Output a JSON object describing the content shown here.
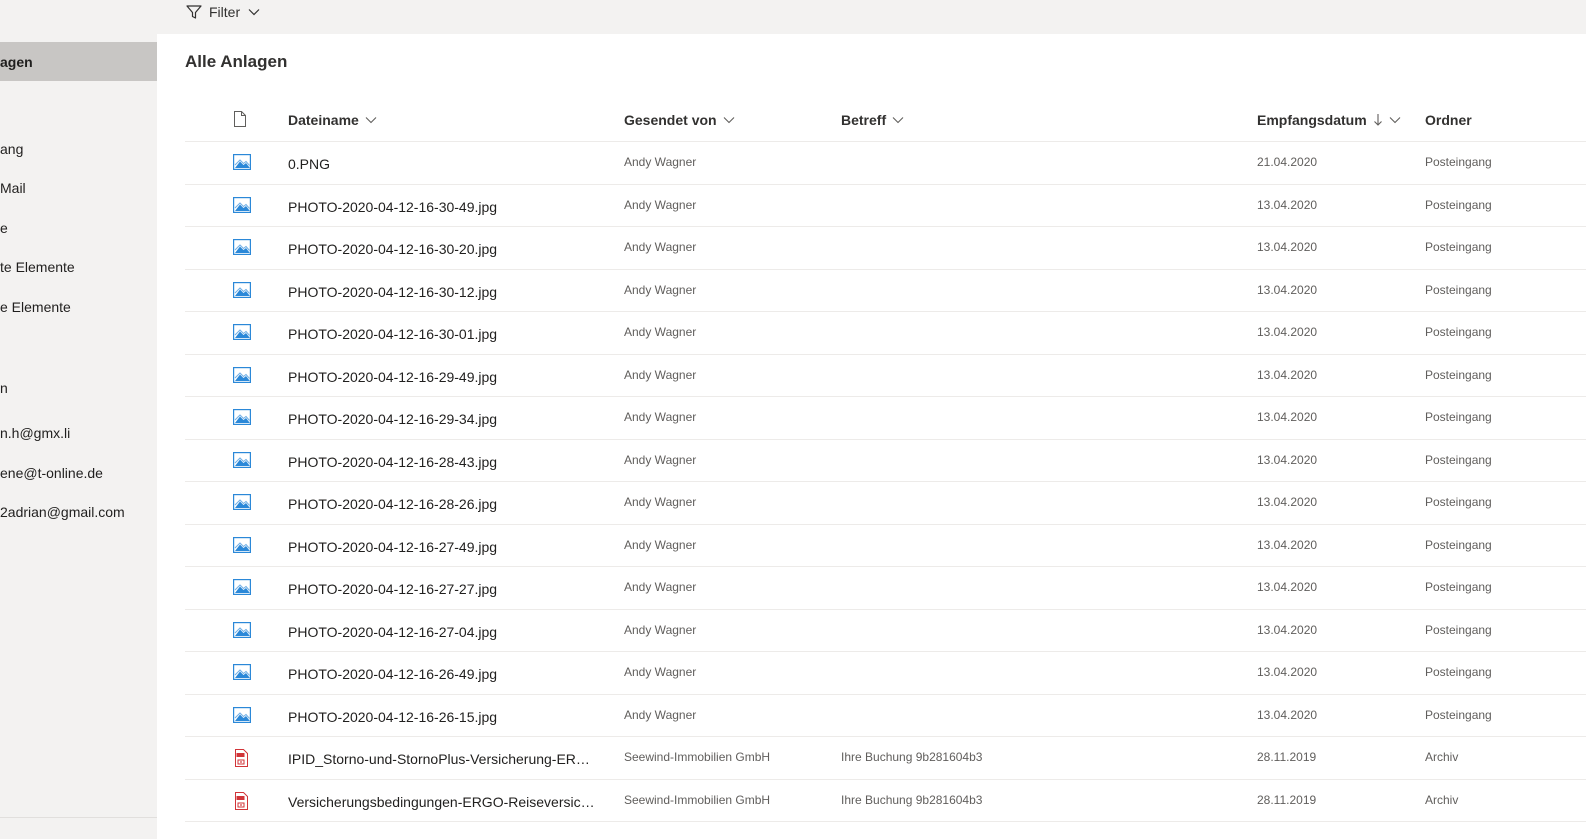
{
  "toolbar": {
    "filter_label": "Filter"
  },
  "sidebar": {
    "items": [
      {
        "label": "agen",
        "selected": true
      },
      {
        "label": "ang"
      },
      {
        "label": "Mail"
      },
      {
        "label": "e"
      },
      {
        "label": "te Elemente"
      },
      {
        "label": "e Elemente"
      },
      {
        "label": "n"
      },
      {
        "label": "n.h@gmx.li"
      },
      {
        "label": "ene@t-online.de"
      },
      {
        "label": "2adrian@gmail.com"
      }
    ]
  },
  "main": {
    "title": "Alle Anlagen",
    "columns": {
      "filename": "Dateiname",
      "sender": "Gesendet von",
      "subject": "Betreff",
      "date": "Empfangsdatum",
      "folder": "Ordner"
    },
    "rows": [
      {
        "icon": "image-file-icon",
        "filename": "0.PNG",
        "sender": "Andy Wagner",
        "subject": "",
        "date": "21.04.2020",
        "folder": "Posteingang"
      },
      {
        "icon": "image-file-icon",
        "filename": "PHOTO-2020-04-12-16-30-49.jpg",
        "sender": "Andy Wagner",
        "subject": "",
        "date": "13.04.2020",
        "folder": "Posteingang"
      },
      {
        "icon": "image-file-icon",
        "filename": "PHOTO-2020-04-12-16-30-20.jpg",
        "sender": "Andy Wagner",
        "subject": "",
        "date": "13.04.2020",
        "folder": "Posteingang"
      },
      {
        "icon": "image-file-icon",
        "filename": "PHOTO-2020-04-12-16-30-12.jpg",
        "sender": "Andy Wagner",
        "subject": "",
        "date": "13.04.2020",
        "folder": "Posteingang"
      },
      {
        "icon": "image-file-icon",
        "filename": "PHOTO-2020-04-12-16-30-01.jpg",
        "sender": "Andy Wagner",
        "subject": "",
        "date": "13.04.2020",
        "folder": "Posteingang"
      },
      {
        "icon": "image-file-icon",
        "filename": "PHOTO-2020-04-12-16-29-49.jpg",
        "sender": "Andy Wagner",
        "subject": "",
        "date": "13.04.2020",
        "folder": "Posteingang"
      },
      {
        "icon": "image-file-icon",
        "filename": "PHOTO-2020-04-12-16-29-34.jpg",
        "sender": "Andy Wagner",
        "subject": "",
        "date": "13.04.2020",
        "folder": "Posteingang"
      },
      {
        "icon": "image-file-icon",
        "filename": "PHOTO-2020-04-12-16-28-43.jpg",
        "sender": "Andy Wagner",
        "subject": "",
        "date": "13.04.2020",
        "folder": "Posteingang"
      },
      {
        "icon": "image-file-icon",
        "filename": "PHOTO-2020-04-12-16-28-26.jpg",
        "sender": "Andy Wagner",
        "subject": "",
        "date": "13.04.2020",
        "folder": "Posteingang"
      },
      {
        "icon": "image-file-icon",
        "filename": "PHOTO-2020-04-12-16-27-49.jpg",
        "sender": "Andy Wagner",
        "subject": "",
        "date": "13.04.2020",
        "folder": "Posteingang"
      },
      {
        "icon": "image-file-icon",
        "filename": "PHOTO-2020-04-12-16-27-27.jpg",
        "sender": "Andy Wagner",
        "subject": "",
        "date": "13.04.2020",
        "folder": "Posteingang"
      },
      {
        "icon": "image-file-icon",
        "filename": "PHOTO-2020-04-12-16-27-04.jpg",
        "sender": "Andy Wagner",
        "subject": "",
        "date": "13.04.2020",
        "folder": "Posteingang"
      },
      {
        "icon": "image-file-icon",
        "filename": "PHOTO-2020-04-12-16-26-49.jpg",
        "sender": "Andy Wagner",
        "subject": "",
        "date": "13.04.2020",
        "folder": "Posteingang"
      },
      {
        "icon": "image-file-icon",
        "filename": "PHOTO-2020-04-12-16-26-15.jpg",
        "sender": "Andy Wagner",
        "subject": "",
        "date": "13.04.2020",
        "folder": "Posteingang"
      },
      {
        "icon": "pdf-file-icon",
        "filename": "IPID_Storno-und-StornoPlus-Versicherung-ERGO....",
        "sender": "Seewind-Immobilien GmbH",
        "subject": "Ihre Buchung 9b281604b3",
        "date": "28.11.2019",
        "folder": "Archiv"
      },
      {
        "icon": "pdf-file-icon",
        "filename": "Versicherungsbedingungen-ERGO-Reiseversicher...",
        "sender": "Seewind-Immobilien GmbH",
        "subject": "Ihre Buchung 9b281604b3",
        "date": "28.11.2019",
        "folder": "Archiv"
      }
    ]
  },
  "colors": {
    "image_icon_blue": "#2b88d8",
    "pdf_icon_red": "#d13438",
    "sidebar_bg": "#f3f2f1",
    "sidebar_selected_bg": "#c8c6c4"
  }
}
